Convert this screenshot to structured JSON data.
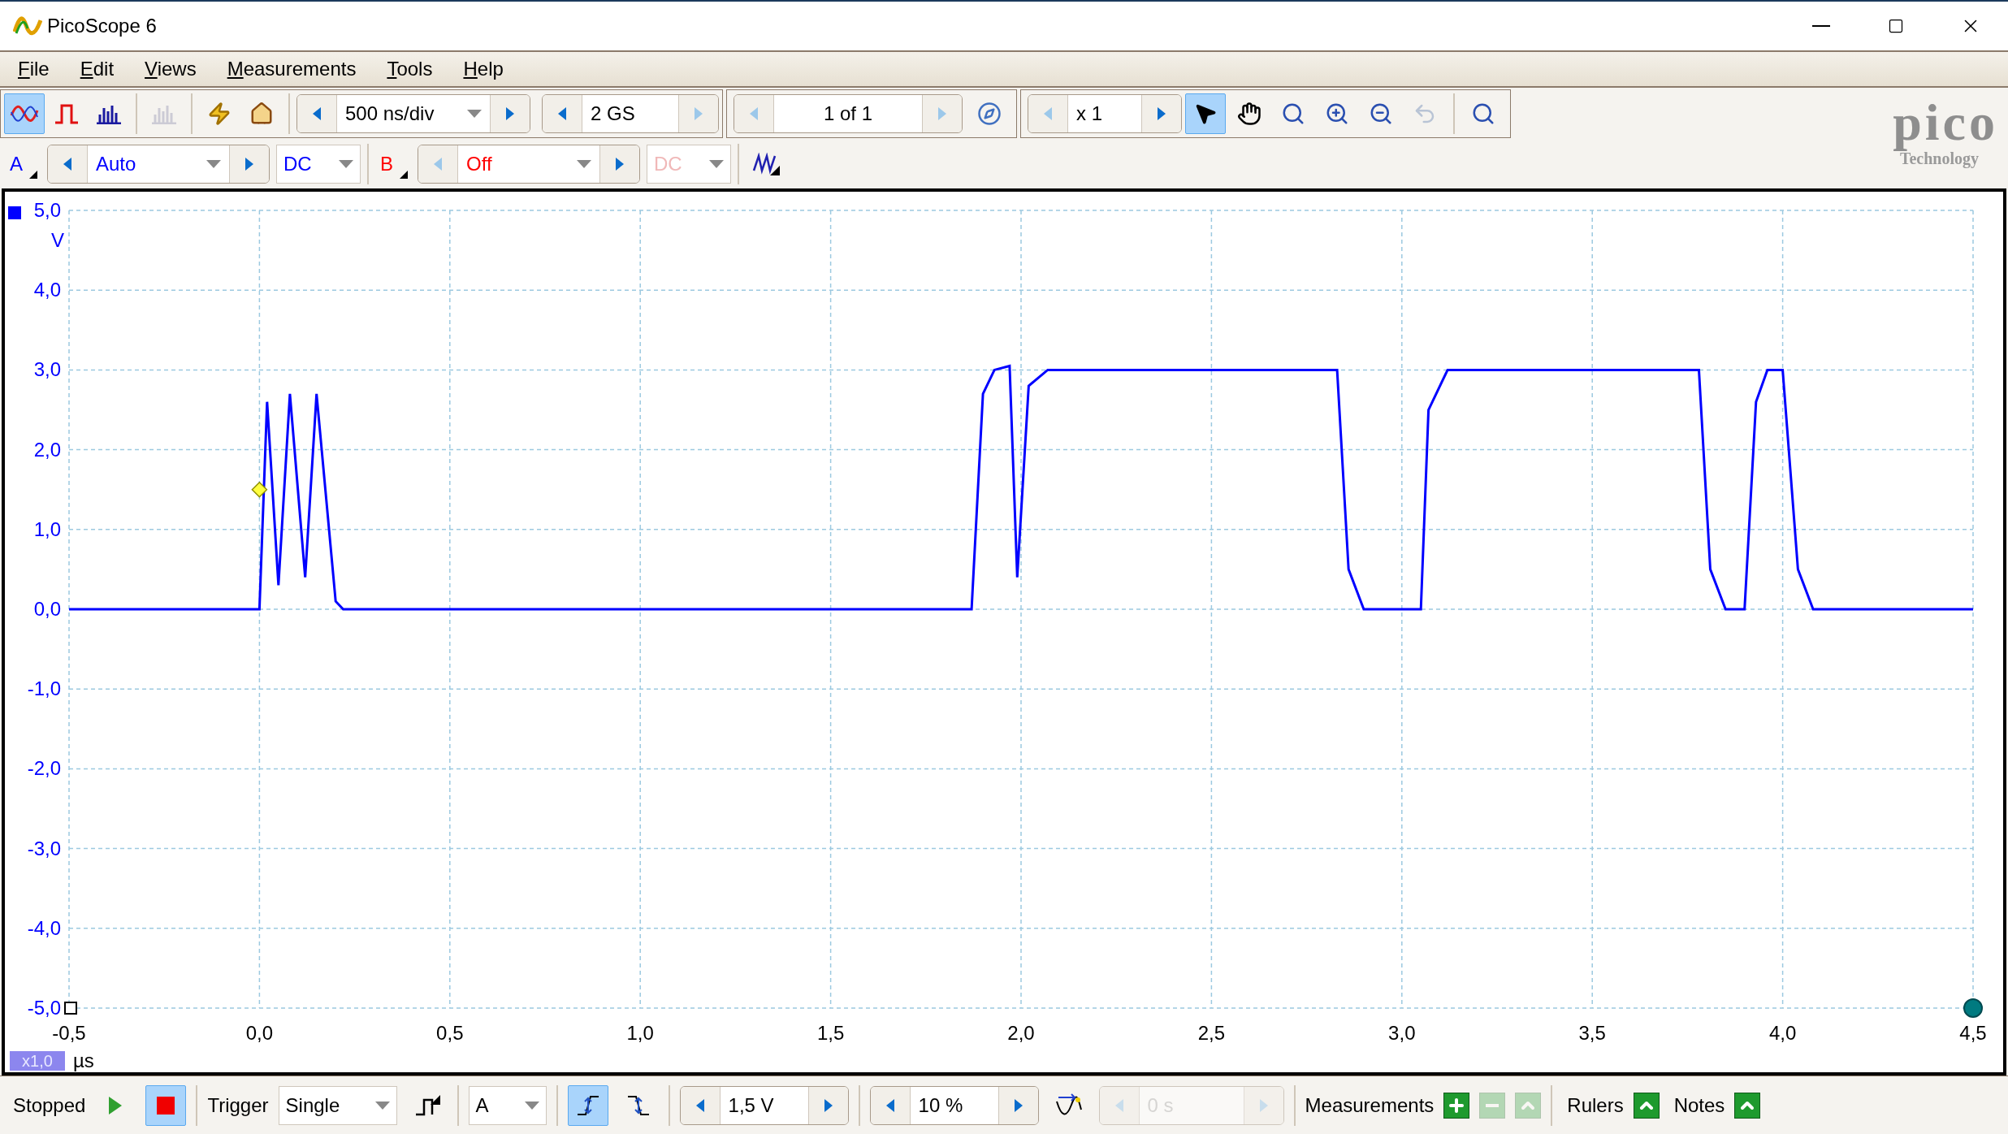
{
  "window": {
    "title": "PicoScope 6"
  },
  "menu": [
    {
      "label": "File"
    },
    {
      "label": "Edit"
    },
    {
      "label": "Views"
    },
    {
      "label": "Measurements"
    },
    {
      "label": "Tools"
    },
    {
      "label": "Help"
    }
  ],
  "view_modes": [
    {
      "selected": true,
      "disabled": false
    },
    {
      "selected": false,
      "disabled": false
    },
    {
      "selected": false,
      "disabled": false
    },
    {
      "selected": false,
      "disabled": true
    }
  ],
  "timebase": "500 ns/div",
  "samples": "2 GS",
  "buffer": "1 of 1",
  "zoom_factor": "x 1",
  "tools": [
    {
      "selected": true,
      "disabled": false
    },
    {
      "selected": false,
      "disabled": false
    },
    {
      "selected": false,
      "disabled": false
    },
    {
      "selected": false,
      "disabled": false
    },
    {
      "selected": false,
      "disabled": false
    },
    {
      "selected": false,
      "disabled": true
    }
  ],
  "logo": {
    "name": "pico",
    "tagline": "Technology"
  },
  "channels": [
    {
      "label": "A",
      "range": "Auto",
      "coupling": "DC",
      "enabled": true,
      "color": "#0000ff"
    },
    {
      "label": "B",
      "range": "Off",
      "coupling": "DC",
      "enabled": false,
      "color": "#ff0000"
    }
  ],
  "scope": {
    "probe_scale": "x1,0",
    "chart_data": {
      "type": "line",
      "xlabel": "µs",
      "ylabel": "V",
      "x": [
        -0.5,
        0.0,
        0.02,
        0.05,
        0.08,
        0.12,
        0.15,
        0.2,
        0.22,
        1.87,
        1.9,
        1.93,
        1.97,
        1.99,
        2.02,
        2.07,
        2.83,
        2.86,
        2.9,
        3.05,
        3.07,
        3.12,
        3.78,
        3.81,
        3.85,
        3.9,
        3.93,
        3.96,
        4.0,
        4.04,
        4.08,
        4.5
      ],
      "grid": true,
      "series": [
        {
          "color": "#0000ff",
          "values": [
            0,
            0,
            2.6,
            0.3,
            2.7,
            0.4,
            2.7,
            0.1,
            0,
            0,
            2.7,
            3.0,
            3.05,
            0.4,
            2.8,
            3.0,
            3.0,
            0.5,
            0,
            0,
            2.5,
            3.0,
            3.0,
            0.5,
            0,
            0,
            2.6,
            3.0,
            3.0,
            0.5,
            0,
            0
          ]
        }
      ],
      "xlim": [
        -0.5,
        4.5
      ],
      "ylim": [
        -5,
        5
      ],
      "xticks": [
        {
          "value": -0.5,
          "label": "-0,5"
        },
        {
          "value": 0,
          "label": "0,0"
        },
        {
          "value": 0.5,
          "label": "0,5"
        },
        {
          "value": 1,
          "label": "1,0"
        },
        {
          "value": 1.5,
          "label": "1,5"
        },
        {
          "value": 2,
          "label": "2,0"
        },
        {
          "value": 2.5,
          "label": "2,5"
        },
        {
          "value": 3,
          "label": "3,0"
        },
        {
          "value": 3.5,
          "label": "3,5"
        },
        {
          "value": 4,
          "label": "4,0"
        },
        {
          "value": 4.5,
          "label": "4,5"
        }
      ],
      "yticks": [
        {
          "value": 5,
          "label": "5,0"
        },
        {
          "value": 4,
          "label": "4,0"
        },
        {
          "value": 3,
          "label": "3,0"
        },
        {
          "value": 2,
          "label": "2,0"
        },
        {
          "value": 1,
          "label": "1,0"
        },
        {
          "value": 0,
          "label": "0,0"
        },
        {
          "value": -1,
          "label": "-1,0"
        },
        {
          "value": -2,
          "label": "-2,0"
        },
        {
          "value": -3,
          "label": "-3,0"
        },
        {
          "value": -4,
          "label": "-4,0"
        },
        {
          "value": -5,
          "label": "-5,0"
        }
      ]
    }
  },
  "status_bar": {
    "status": "Stopped",
    "running": false,
    "trigger_label": "Trigger",
    "trigger_mode": "Single",
    "trigger_source": "A",
    "edges": [
      {
        "selected": true
      },
      {
        "selected": false
      }
    ],
    "threshold": "1,5 V",
    "pre_trigger": "10 %",
    "delay": "0 s",
    "delay_enabled": false,
    "measurements_label": "Measurements",
    "measurement_buttons": [
      {
        "disabled": false
      },
      {
        "disabled": true
      },
      {
        "disabled": true
      }
    ],
    "panels": [
      {
        "label": "Rulers"
      },
      {
        "label": "Notes"
      }
    ]
  }
}
